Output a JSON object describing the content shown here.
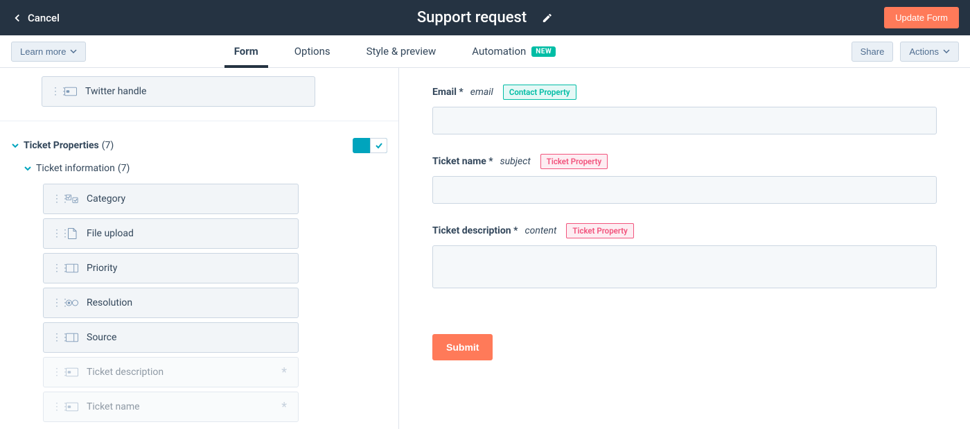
{
  "header": {
    "cancel": "Cancel",
    "title": "Support request",
    "update": "Update Form"
  },
  "subheader": {
    "learn": "Learn more",
    "tabs": [
      {
        "label": "Form",
        "active": true
      },
      {
        "label": "Options"
      },
      {
        "label": "Style & preview"
      },
      {
        "label": "Automation",
        "badge": "NEW"
      }
    ],
    "share": "Share",
    "actions": "Actions"
  },
  "left": {
    "orphan": {
      "label": "Twitter handle",
      "icon": "text"
    },
    "group": {
      "title": "Ticket Properties",
      "count": "(7)",
      "sub_title": "Ticket information",
      "sub_count": "(7)",
      "fields": [
        {
          "label": "Category",
          "icon": "checkboxes",
          "disabled": false
        },
        {
          "label": "File upload",
          "icon": "file",
          "disabled": false
        },
        {
          "label": "Priority",
          "icon": "select",
          "disabled": false
        },
        {
          "label": "Resolution",
          "icon": "radio",
          "disabled": false
        },
        {
          "label": "Source",
          "icon": "select",
          "disabled": false
        },
        {
          "label": "Ticket description",
          "icon": "text",
          "disabled": true,
          "required": true
        },
        {
          "label": "Ticket name",
          "icon": "text",
          "disabled": true,
          "required": true
        }
      ]
    }
  },
  "form": {
    "fields": [
      {
        "label": "Email",
        "required": "*",
        "internal": "email",
        "badge": "Contact Property",
        "badge_type": "contact",
        "kind": "text"
      },
      {
        "label": "Ticket name",
        "required": "*",
        "internal": "subject",
        "badge": "Ticket Property",
        "badge_type": "ticket",
        "kind": "text"
      },
      {
        "label": "Ticket description",
        "required": "*",
        "internal": "content",
        "badge": "Ticket Property",
        "badge_type": "ticket",
        "kind": "textarea"
      }
    ],
    "submit": "Submit"
  }
}
